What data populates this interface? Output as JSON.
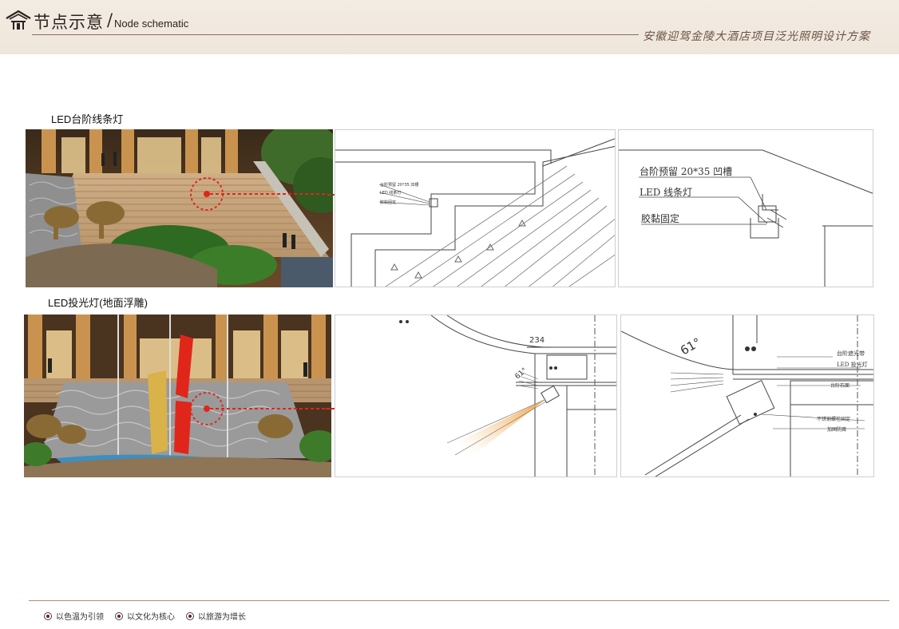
{
  "header": {
    "title_cn": "节点示意",
    "title_en": "Node schematic",
    "separator": "/",
    "project": "安徽迎驾金陵大酒店项目泛光照明设计方案"
  },
  "sections": [
    {
      "label": "LED台阶线条灯",
      "detail_labels": [
        "台阶预留 20*35 凹槽",
        "LED 线条灯",
        "胶黏固定"
      ]
    },
    {
      "label": "LED投光灯(地面浮雕)",
      "dimension": "234",
      "angle": "61°",
      "detail_labels": [
        "台阶遮光带",
        "LED 投光灯",
        "不锈钢螺栓固定",
        "台阶石面",
        "加固防腐"
      ]
    }
  ],
  "footer": {
    "items": [
      "以色温为引领",
      "以文化为核心",
      "以旅游为增长"
    ]
  },
  "colors": {
    "accent_red": "#e0261b",
    "header_bg": "#f1e9df",
    "line_brown": "#8a6d5a"
  }
}
